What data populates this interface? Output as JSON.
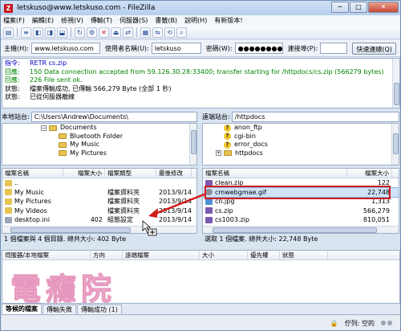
{
  "window": {
    "title": "letskuso@www.letskuso.com - FileZilla",
    "controls": [
      "─",
      "□",
      "✕"
    ]
  },
  "menu": [
    "檔案(F)",
    "編輯(E)",
    "檢視(V)",
    "傳輸(T)",
    "伺服器(S)",
    "書籤(B)",
    "說明(H)",
    "有新版本!"
  ],
  "toolbar_icons": [
    "site-manager-icon",
    "toggle-log-icon",
    "toggle-local-tree-icon",
    "toggle-remote-tree-icon",
    "toggle-queue-icon",
    "refresh-icon",
    "process-queue-icon",
    "cancel-icon",
    "disconnect-icon",
    "reconnect-icon",
    "filter-icon",
    "compare-icon",
    "sync-browse-icon",
    "search-icon"
  ],
  "quickconnect": {
    "host_label": "主機(H):",
    "host_value": "www.letskuso.com",
    "user_label": "使用者名稱(U):",
    "user_value": "letskuso",
    "pass_label": "密碼(W):",
    "pass_value": "●●●●●●●●",
    "port_label": "連接埠(P):",
    "port_value": "",
    "button": "快速連線(Q)"
  },
  "log": [
    {
      "tag": "指令:",
      "msg": "RETR cs.zip",
      "kind": "cmd"
    },
    {
      "tag": "回應:",
      "msg": "150 Data connection accepted from 59.126.30.28:33400; transfer starting for /httpdocs/cs.zip (566279 bytes)",
      "kind": "ok"
    },
    {
      "tag": "回應:",
      "msg": "226 File sent ok.",
      "kind": "ok"
    },
    {
      "tag": "狀態:",
      "msg": "檔案傳輸成功, 已傳輸 566,279 Byte (全部 1 秒)",
      "kind": "st"
    },
    {
      "tag": "狀態:",
      "msg": "已從伺服器離線",
      "kind": "st"
    }
  ],
  "local": {
    "site_label": "本地站台:",
    "site_path": "C:\\Users\\Andrew\\Documents\\",
    "tree": [
      "Documents",
      "Bluetooth Folder",
      "My Music",
      "My Pictures"
    ],
    "headers": [
      "檔案名稱",
      "檔案大小",
      "檔案類型",
      "最後修改"
    ],
    "files": [
      {
        "name": "..",
        "size": "",
        "type": "",
        "date": ""
      },
      {
        "name": "My Music",
        "size": "",
        "type": "檔案資料夾",
        "date": "2013/9/14"
      },
      {
        "name": "My Pictures",
        "size": "",
        "type": "檔案資料夾",
        "date": "2013/9/14"
      },
      {
        "name": "My Videos",
        "size": "",
        "type": "檔案資料夾",
        "date": "2013/9/14"
      },
      {
        "name": "desktop.ini",
        "size": "402",
        "type": "組態設定",
        "date": "2013/9/14"
      }
    ],
    "status": "1 個檔案與 4 個目錄. 總共大小: 402 Byte"
  },
  "remote": {
    "site_label": "遠端站台:",
    "site_path": "/httpdocs",
    "tree": [
      "anon_ftp",
      "cgi-bin",
      "error_docs",
      "httpdocs"
    ],
    "headers": [
      "檔案名稱",
      "檔案大小"
    ],
    "files": [
      {
        "name": "clean.zip",
        "size": "122"
      },
      {
        "name": "cmwebgmae.gif",
        "size": "22,748"
      },
      {
        "name": "cn.jpg",
        "size": "1,313"
      },
      {
        "name": "cs.zip",
        "size": "566,279"
      },
      {
        "name": "cs1003.zip",
        "size": "810,051"
      }
    ],
    "status": "選取 1 個檔案. 總共大小: 22,748 Byte"
  },
  "queue": {
    "headers": [
      "伺服器/本地檔案",
      "方向",
      "遠端檔案",
      "大小",
      "優先權",
      "狀態"
    ]
  },
  "watermark": "電癮院",
  "queue_tabs": [
    "等候的檔案",
    "傳輸失敗",
    "傳輸成功 (1)"
  ],
  "statusbar": {
    "queue_text": "佇列: 空的"
  },
  "colors": {
    "highlight": "#d21c1c",
    "command": "#0000c8",
    "response": "#008400"
  }
}
